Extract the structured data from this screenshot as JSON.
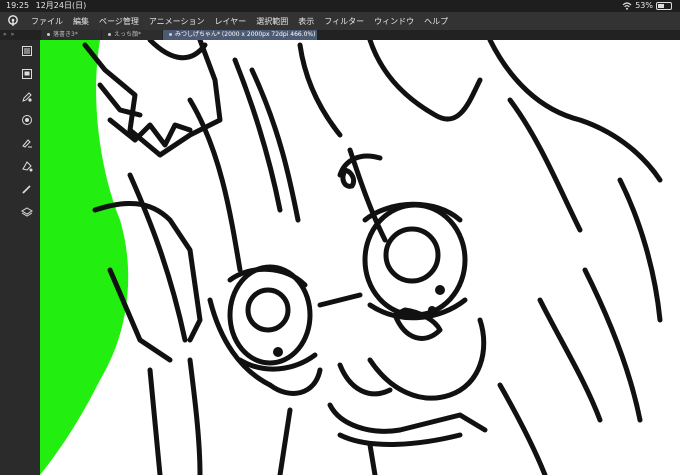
{
  "status": {
    "time": "19:25",
    "date": "12月24日(日)",
    "battery_text": "53%",
    "battery_level": 0.53
  },
  "menu": [
    "ファイル",
    "編集",
    "ページ管理",
    "アニメーション",
    "レイヤー",
    "選択範囲",
    "表示",
    "フィルター",
    "ウィンドウ",
    "ヘルプ"
  ],
  "tabs": [
    {
      "label": "落書き3*",
      "active": false
    },
    {
      "label": "えっち顔*",
      "active": false
    },
    {
      "label": "みつしげちゃん* (2000 x 2000px 72dpi 466.0%)",
      "active": true
    }
  ],
  "tabbar_collapse": "» »",
  "tools": [
    {
      "name": "layer-panel-icon"
    },
    {
      "name": "navigator-icon"
    },
    {
      "name": "pen-tool-icon"
    },
    {
      "name": "color-wheel-icon"
    },
    {
      "name": "brush-tool-icon"
    },
    {
      "name": "fill-tool-icon"
    },
    {
      "name": "pencil-icon"
    },
    {
      "name": "layers-stack-icon"
    }
  ],
  "colors": {
    "green_bg": "#22ee10",
    "line": "#111111",
    "tab_active": "#4d5a73"
  }
}
